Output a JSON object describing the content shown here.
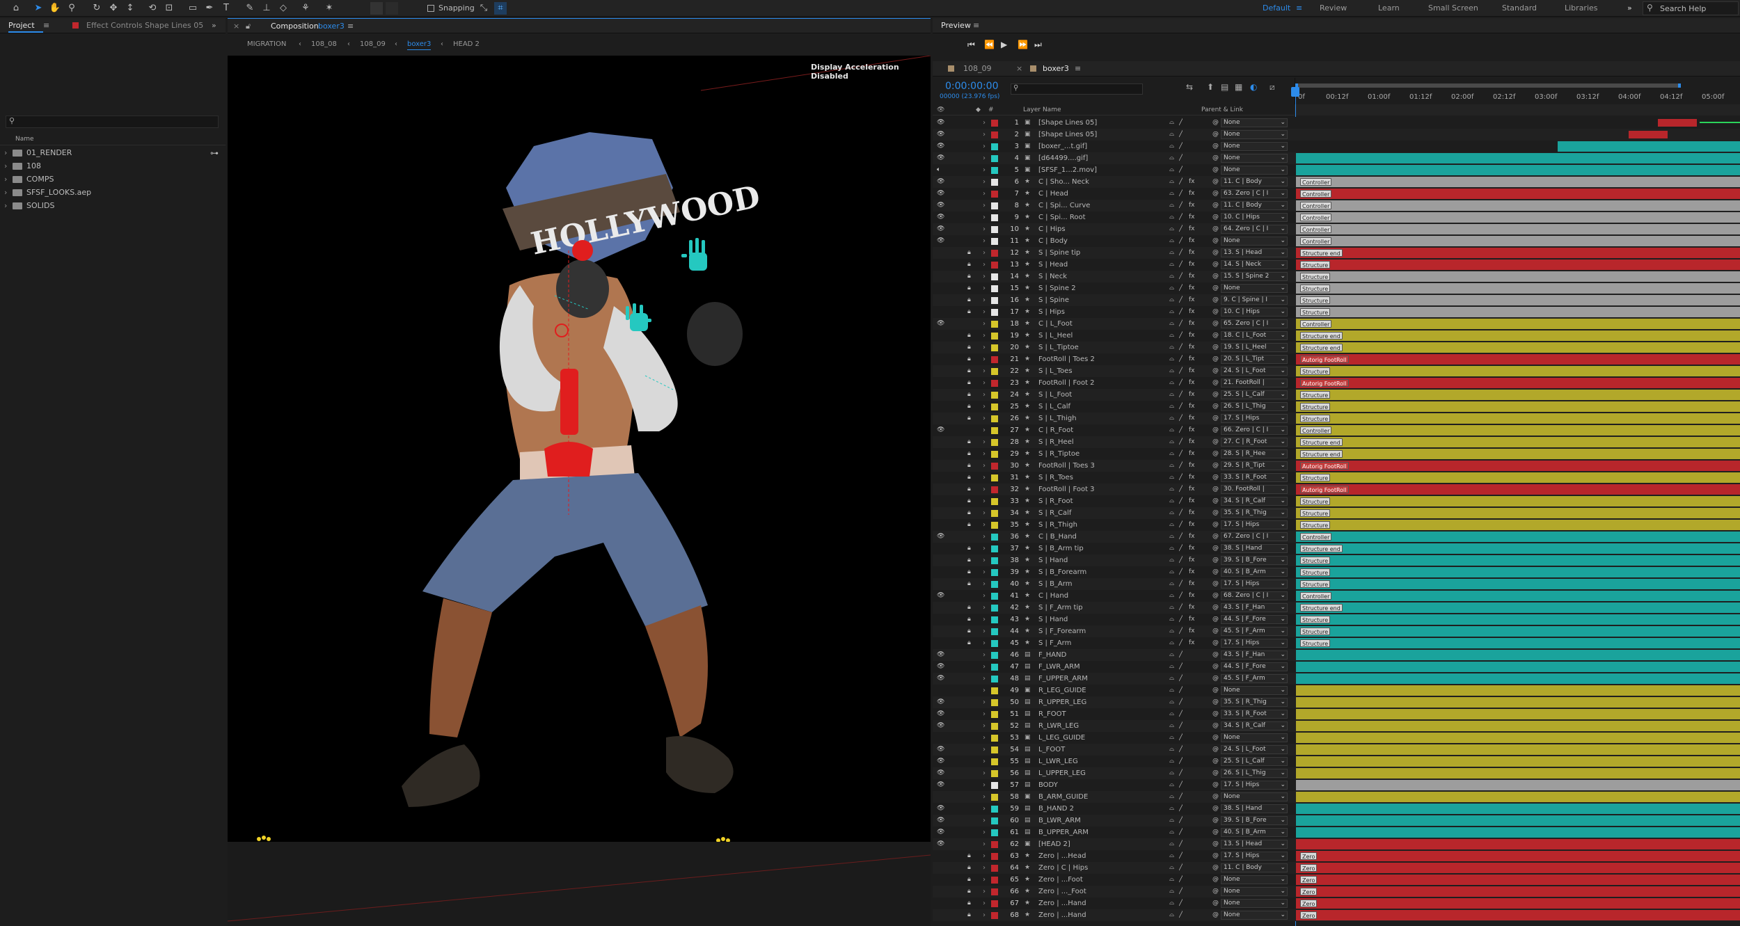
{
  "toolbar": {
    "snapping_label": "Snapping",
    "workspaces": [
      "Default",
      "Review",
      "Learn",
      "Small Screen",
      "Standard",
      "Libraries"
    ],
    "active_workspace": "Default",
    "search_help": "Search Help"
  },
  "project": {
    "tab_project": "Project",
    "tab_effect_controls": "Effect Controls Shape Lines 05",
    "column_name": "Name",
    "items": [
      "01_RENDER",
      "108",
      "COMPS",
      "SFSF_LOOKS.aep",
      "SOLIDS"
    ]
  },
  "composition": {
    "tab_prefix": "Composition",
    "tab_name": "boxer3",
    "breadcrumbs": [
      "MIGRATION",
      "108_08",
      "108_09",
      "boxer3",
      "HEAD 2"
    ],
    "active_breadcrumb": "boxer3",
    "notice": "Display Acceleration Disabled",
    "sign_text": "HOLLYWOOD"
  },
  "preview": {
    "tab": "Preview",
    "timeline_tabs": [
      "108_09",
      "boxer3"
    ],
    "active_timeline_tab": "boxer3",
    "timecode": "0:00:00:00",
    "frame_info": "00000 (23.976 fps)",
    "col_layer_name": "Layer Name",
    "col_parent": "Parent & Link",
    "ruler": [
      "0f",
      "00:12f",
      "01:00f",
      "01:12f",
      "02:00f",
      "02:12f",
      "03:00f",
      "03:12f",
      "04:00f",
      "04:12f",
      "05:00f"
    ]
  },
  "colors": {
    "accent": "#2d8ceb",
    "red": "#c1272d",
    "yellow": "#d6c62a",
    "cyan": "#25c8c0",
    "white": "#e6e6e6",
    "bar_red": "#b8262b",
    "bar_yellow": "#b2a82a",
    "bar_teal": "#1aa39c",
    "bar_gray": "#9d9d9d"
  },
  "layers": [
    {
      "n": "1",
      "name": "[Shape Lines 05]",
      "parent": "None",
      "c": "red",
      "bar": "none",
      "mk": ""
    },
    {
      "n": "2",
      "name": "[Shape Lines 05]",
      "parent": "None",
      "c": "red",
      "bar": "none",
      "mk": ""
    },
    {
      "n": "3",
      "name": "[boxer_...t.gif]",
      "parent": "None",
      "c": "cyan",
      "bar": "none",
      "mk": ""
    },
    {
      "n": "4",
      "name": "[d64499....gif]",
      "parent": "None",
      "c": "cyan",
      "bar": "teal",
      "mk": ""
    },
    {
      "n": "5",
      "name": "[SFSF_1...2.mov]",
      "parent": "None",
      "c": "cyan",
      "bar": "teal",
      "mk": ""
    },
    {
      "n": "6",
      "name": "C | Sho... Neck",
      "parent": "11. C | Body",
      "c": "white",
      "bar": "gray",
      "mk": "Controller"
    },
    {
      "n": "7",
      "name": "C | Head",
      "parent": "63. Zero | C | I",
      "c": "red",
      "bar": "red",
      "mk": "Controller"
    },
    {
      "n": "8",
      "name": "C | Spi... Curve",
      "parent": "11. C | Body",
      "c": "white",
      "bar": "gray",
      "mk": "Controller"
    },
    {
      "n": "9",
      "name": "C | Spi... Root",
      "parent": "10. C | Hips",
      "c": "white",
      "bar": "gray",
      "mk": "Controller"
    },
    {
      "n": "10",
      "name": "C | Hips",
      "parent": "64. Zero | C | I",
      "c": "white",
      "bar": "gray",
      "mk": "Controller"
    },
    {
      "n": "11",
      "name": "C | Body",
      "parent": "None",
      "c": "white",
      "bar": "gray",
      "mk": "Controller"
    },
    {
      "n": "12",
      "name": "S | Spine tip",
      "parent": "13. S | Head",
      "c": "red",
      "bar": "red",
      "mk": "Structure end"
    },
    {
      "n": "13",
      "name": "S | Head",
      "parent": "14. S | Neck",
      "c": "red",
      "bar": "red",
      "mk": "Structure"
    },
    {
      "n": "14",
      "name": "S | Neck",
      "parent": "15. S | Spine 2",
      "c": "white",
      "bar": "gray",
      "mk": "Structure"
    },
    {
      "n": "15",
      "name": "S | Spine 2",
      "parent": "None",
      "c": "white",
      "bar": "gray",
      "mk": "Structure"
    },
    {
      "n": "16",
      "name": "S | Spine",
      "parent": "9. C | Spine | I",
      "c": "white",
      "bar": "gray",
      "mk": "Structure"
    },
    {
      "n": "17",
      "name": "S | Hips",
      "parent": "10. C | Hips",
      "c": "white",
      "bar": "gray",
      "mk": "Structure"
    },
    {
      "n": "18",
      "name": "C | L_Foot",
      "parent": "65. Zero | C | I",
      "c": "yellow",
      "bar": "yellow",
      "mk": "Controller"
    },
    {
      "n": "19",
      "name": "S | L_Heel",
      "parent": "18. C | L_Foot",
      "c": "yellow",
      "bar": "yellow",
      "mk": "Structure end"
    },
    {
      "n": "20",
      "name": "S | L_Tiptoe",
      "parent": "19. S | L_Heel",
      "c": "yellow",
      "bar": "yellow",
      "mk": "Structure end"
    },
    {
      "n": "21",
      "name": "FootRoll | Toes 2",
      "parent": "20. S | L_Tipt",
      "c": "red",
      "bar": "red",
      "mk": "Autorig FootRoll"
    },
    {
      "n": "22",
      "name": "S | L_Toes",
      "parent": "24. S | L_Foot",
      "c": "yellow",
      "bar": "yellow",
      "mk": "Structure"
    },
    {
      "n": "23",
      "name": "FootRoll | Foot 2",
      "parent": "21. FootRoll |",
      "c": "red",
      "bar": "red",
      "mk": "Autorig FootRoll"
    },
    {
      "n": "24",
      "name": "S | L_Foot",
      "parent": "25. S | L_Calf",
      "c": "yellow",
      "bar": "yellow",
      "mk": "Structure"
    },
    {
      "n": "25",
      "name": "S | L_Calf",
      "parent": "26. S | L_Thig",
      "c": "yellow",
      "bar": "yellow",
      "mk": "Structure"
    },
    {
      "n": "26",
      "name": "S | L_Thigh",
      "parent": "17. S | Hips",
      "c": "yellow",
      "bar": "yellow",
      "mk": "Structure"
    },
    {
      "n": "27",
      "name": "C | R_Foot",
      "parent": "66. Zero | C | I",
      "c": "yellow",
      "bar": "yellow",
      "mk": "Controller"
    },
    {
      "n": "28",
      "name": "S | R_Heel",
      "parent": "27. C | R_Foot",
      "c": "yellow",
      "bar": "yellow",
      "mk": "Structure end"
    },
    {
      "n": "29",
      "name": "S | R_Tiptoe",
      "parent": "28. S | R_Hee",
      "c": "yellow",
      "bar": "yellow",
      "mk": "Structure end"
    },
    {
      "n": "30",
      "name": "FootRoll | Toes 3",
      "parent": "29. S | R_Tipt",
      "c": "red",
      "bar": "red",
      "mk": "Autorig FootRoll"
    },
    {
      "n": "31",
      "name": "S | R_Toes",
      "parent": "33. S | R_Foot",
      "c": "yellow",
      "bar": "yellow",
      "mk": "Structure"
    },
    {
      "n": "32",
      "name": "FootRoll | Foot 3",
      "parent": "30. FootRoll |",
      "c": "red",
      "bar": "red",
      "mk": "Autorig FootRoll"
    },
    {
      "n": "33",
      "name": "S | R_Foot",
      "parent": "34. S | R_Calf",
      "c": "yellow",
      "bar": "yellow",
      "mk": "Structure"
    },
    {
      "n": "34",
      "name": "S | R_Calf",
      "parent": "35. S | R_Thig",
      "c": "yellow",
      "bar": "yellow",
      "mk": "Structure"
    },
    {
      "n": "35",
      "name": "S | R_Thigh",
      "parent": "17. S | Hips",
      "c": "yellow",
      "bar": "yellow",
      "mk": "Structure"
    },
    {
      "n": "36",
      "name": "C | B_Hand",
      "parent": "67. Zero | C | I",
      "c": "cyan",
      "bar": "teal",
      "mk": "Controller"
    },
    {
      "n": "37",
      "name": "S | B_Arm tip",
      "parent": "38. S | Hand",
      "c": "cyan",
      "bar": "teal",
      "mk": "Structure end"
    },
    {
      "n": "38",
      "name": "S | Hand",
      "parent": "39. S | B_Fore",
      "c": "cyan",
      "bar": "teal",
      "mk": "Structure"
    },
    {
      "n": "39",
      "name": "S | B_Forearm",
      "parent": "40. S | B_Arm",
      "c": "cyan",
      "bar": "teal",
      "mk": "Structure"
    },
    {
      "n": "40",
      "name": "S | B_Arm",
      "parent": "17. S | Hips",
      "c": "cyan",
      "bar": "teal",
      "mk": "Structure"
    },
    {
      "n": "41",
      "name": "C | Hand",
      "parent": "68. Zero | C | I",
      "c": "cyan",
      "bar": "teal",
      "mk": "Controller"
    },
    {
      "n": "42",
      "name": "S | F_Arm tip",
      "parent": "43. S | F_Han",
      "c": "cyan",
      "bar": "teal",
      "mk": "Structure end"
    },
    {
      "n": "43",
      "name": "S | Hand",
      "parent": "44. S | F_Fore",
      "c": "cyan",
      "bar": "teal",
      "mk": "Structure"
    },
    {
      "n": "44",
      "name": "S | F_Forearm",
      "parent": "45. S | F_Arm",
      "c": "cyan",
      "bar": "teal",
      "mk": "Structure"
    },
    {
      "n": "45",
      "name": "S | F_Arm",
      "parent": "17. S | Hips",
      "c": "cyan",
      "bar": "teal",
      "mk": "Structure"
    },
    {
      "n": "46",
      "name": "F_HAND",
      "parent": "43. S | F_Han",
      "c": "cyan",
      "bar": "teal",
      "mk": ""
    },
    {
      "n": "47",
      "name": "F_LWR_ARM",
      "parent": "44. S | F_Fore",
      "c": "cyan",
      "bar": "teal",
      "mk": ""
    },
    {
      "n": "48",
      "name": "F_UPPER_ARM",
      "parent": "45. S | F_Arm",
      "c": "cyan",
      "bar": "teal",
      "mk": ""
    },
    {
      "n": "49",
      "name": "R_LEG_GUIDE",
      "parent": "None",
      "c": "yellow",
      "bar": "yellow",
      "mk": ""
    },
    {
      "n": "50",
      "name": "R_UPPER_LEG",
      "parent": "35. S | R_Thig",
      "c": "yellow",
      "bar": "yellow",
      "mk": ""
    },
    {
      "n": "51",
      "name": "R_FOOT",
      "parent": "33. S | R_Foot",
      "c": "yellow",
      "bar": "yellow",
      "mk": ""
    },
    {
      "n": "52",
      "name": "R_LWR_LEG",
      "parent": "34. S | R_Calf",
      "c": "yellow",
      "bar": "yellow",
      "mk": ""
    },
    {
      "n": "53",
      "name": "L_LEG_GUIDE",
      "parent": "None",
      "c": "yellow",
      "bar": "yellow",
      "mk": ""
    },
    {
      "n": "54",
      "name": "L_FOOT",
      "parent": "24. S | L_Foot",
      "c": "yellow",
      "bar": "yellow",
      "mk": ""
    },
    {
      "n": "55",
      "name": "L_LWR_LEG",
      "parent": "25. S | L_Calf",
      "c": "yellow",
      "bar": "yellow",
      "mk": ""
    },
    {
      "n": "56",
      "name": "L_UPPER_LEG",
      "parent": "26. S | L_Thig",
      "c": "yellow",
      "bar": "yellow",
      "mk": ""
    },
    {
      "n": "57",
      "name": "BODY",
      "parent": "17. S | Hips",
      "c": "white",
      "bar": "gray",
      "mk": ""
    },
    {
      "n": "58",
      "name": "B_ARM_GUIDE",
      "parent": "None",
      "c": "yellow",
      "bar": "yellow",
      "mk": ""
    },
    {
      "n": "59",
      "name": "B_HAND 2",
      "parent": "38. S | Hand",
      "c": "cyan",
      "bar": "teal",
      "mk": ""
    },
    {
      "n": "60",
      "name": "B_LWR_ARM",
      "parent": "39. S | B_Fore",
      "c": "cyan",
      "bar": "teal",
      "mk": ""
    },
    {
      "n": "61",
      "name": "B_UPPER_ARM",
      "parent": "40. S | B_Arm",
      "c": "cyan",
      "bar": "teal",
      "mk": ""
    },
    {
      "n": "62",
      "name": "[HEAD 2]",
      "parent": "13. S | Head",
      "c": "red",
      "bar": "red",
      "mk": ""
    },
    {
      "n": "63",
      "name": "Zero | ...Head",
      "parent": "17. S | Hips",
      "c": "red",
      "bar": "red",
      "mk": "Zero"
    },
    {
      "n": "64",
      "name": "Zero | C | Hips",
      "parent": "11. C | Body",
      "c": "red",
      "bar": "red",
      "mk": "Zero"
    },
    {
      "n": "65",
      "name": "Zero | ...Foot",
      "parent": "None",
      "c": "red",
      "bar": "red",
      "mk": "Zero"
    },
    {
      "n": "66",
      "name": "Zero | ..._Foot",
      "parent": "None",
      "c": "red",
      "bar": "red",
      "mk": "Zero"
    },
    {
      "n": "67",
      "name": "Zero | ...Hand",
      "parent": "None",
      "c": "red",
      "bar": "red",
      "mk": "Zero"
    },
    {
      "n": "68",
      "name": "Zero | ...Hand",
      "parent": "None",
      "c": "red",
      "bar": "red",
      "mk": "Zero"
    }
  ]
}
